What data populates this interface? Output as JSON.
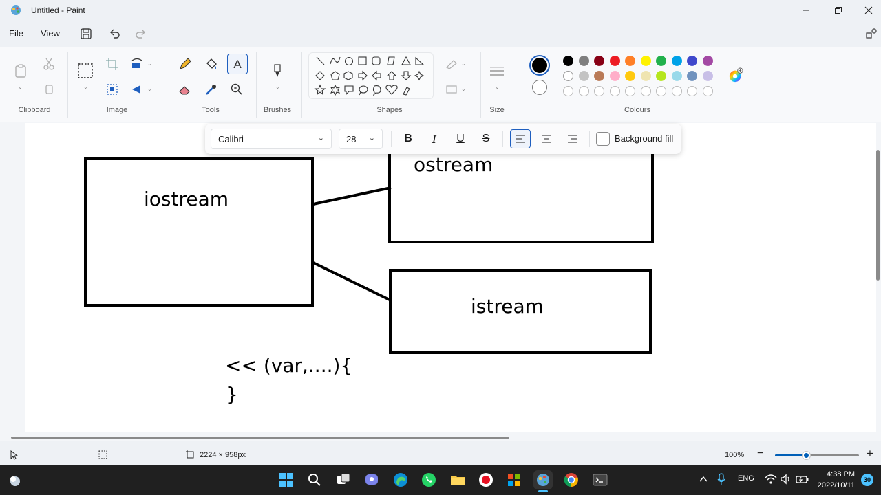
{
  "window": {
    "title": "Untitled - Paint"
  },
  "menu": {
    "file": "File",
    "view": "View"
  },
  "ribbon": {
    "groups": {
      "clipboard": "Clipboard",
      "image": "Image",
      "tools": "Tools",
      "brushes": "Brushes",
      "shapes": "Shapes",
      "size": "Size",
      "colours": "Colours"
    },
    "primary_color": "#000000",
    "secondary_color": "#ffffff",
    "palette_row1": [
      "#000000",
      "#7f7f7f",
      "#880015",
      "#ed1c24",
      "#ff7f27",
      "#fff200",
      "#22b14c",
      "#00a2e8",
      "#3f48cc",
      "#a349a4"
    ],
    "palette_row2": [
      "#ffffff",
      "#c3c3c3",
      "#b97a57",
      "#ffaec9",
      "#ffc90e",
      "#efe4b0",
      "#b5e61d",
      "#99d9ea",
      "#7092be",
      "#c8bfe7"
    ]
  },
  "text_toolbar": {
    "font": "Calibri",
    "size": "28",
    "bold": "B",
    "italic": "I",
    "underline": "U",
    "strike": "S",
    "background_fill": "Background fill"
  },
  "canvas": {
    "texts": {
      "iostream": "iostream",
      "ostream": "ostream",
      "istream": "istream",
      "code_line1": "<< (var,....){",
      "code_line2": "}"
    }
  },
  "status": {
    "dimensions": "2224 × 958px",
    "zoom": "100%",
    "zoom_minus": "−",
    "zoom_plus": "+"
  },
  "taskbar": {
    "lang": "ENG",
    "time": "4:38 PM",
    "date": "2022/10/11",
    "notifications": "30"
  }
}
